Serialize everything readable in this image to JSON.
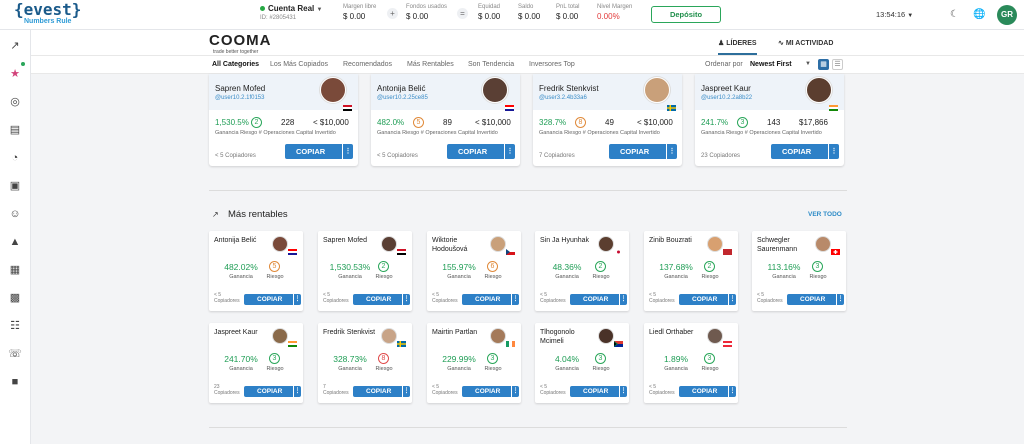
{
  "topbar": {
    "logo": "{evest}",
    "logo_tagline": "Numbers Rule",
    "account_name": "Cuenta Real",
    "account_id": "ID: #2805431",
    "stats": [
      {
        "label": "Margen libre",
        "value": "$ 0.00"
      },
      {
        "label": "Fondos usados",
        "value": "$ 0.00"
      },
      {
        "label": "Equidad",
        "value": "$ 0.00"
      },
      {
        "label": "Saldo",
        "value": "$ 0.00"
      },
      {
        "label": "PnL total",
        "value": "$ 0.00"
      },
      {
        "label": "Nivel Margen",
        "value": "0.00%"
      }
    ],
    "op_plus": "+",
    "op_eq": "=",
    "deposit_label": "Depósito",
    "clock": "13:54:16",
    "user_initials": "GR"
  },
  "cooma": {
    "logo": "COOMA",
    "tagline": "trade better together",
    "tab_leaders": "LÍDERES",
    "tab_activity": "MI ACTIVIDAD"
  },
  "filters": {
    "tabs": [
      "All Categories",
      "Los Más Copiados",
      "Recomendados",
      "Más Rentables",
      "Son Tendencia",
      "Inversores Top"
    ],
    "order_label": "Ordenar por",
    "order_value": "Newest First"
  },
  "labels": {
    "gain": "Ganancia",
    "risk": "Riesgo",
    "ops": "# Operaciones",
    "capital": "Capital Invertido",
    "copy": "COPIAR",
    "copiers_word": "Copiadores"
  },
  "top_cards": [
    {
      "name": "Sapren Mofed",
      "user": "@user10.2.1f0153",
      "gain": "1,530.5%",
      "risk": "2",
      "ops": "228",
      "capital": "< $10,000",
      "copiers": "< 5 Copiadores",
      "flag": "eg"
    },
    {
      "name": "Antonija Belić",
      "user": "@user10.2.25ce85",
      "gain": "482.0%",
      "risk": "5",
      "ops": "89",
      "capital": "< $10,000",
      "copiers": "< 5 Copiadores",
      "flag": "hr"
    },
    {
      "name": "Fredrik Stenkvist",
      "user": "@user3.2.4b33a6",
      "gain": "328.7%",
      "risk": "8",
      "ops": "49",
      "capital": "< $10,000",
      "copiers": "7 Copiadores",
      "flag": "se"
    },
    {
      "name": "Jaspreet Kaur",
      "user": "@user10.2.2a8b22",
      "gain": "241.7%",
      "risk": "3",
      "ops": "143",
      "capital": "$17,866",
      "copiers": "23 Copiadores",
      "flag": "in"
    }
  ],
  "section": {
    "title": "Más rentables",
    "view_all": "VER TODO"
  },
  "small_cards": [
    {
      "name": "Antonija Belić",
      "gain": "482.02%",
      "risk": "5",
      "copiers_count": "< 5",
      "flag": "hr"
    },
    {
      "name": "Sapren Mofed",
      "gain": "1,530.53%",
      "risk": "2",
      "copiers_count": "< 5",
      "flag": "eg"
    },
    {
      "name": "Wiktorie Hodoušová",
      "gain": "155.97%",
      "risk": "6",
      "copiers_count": "< 5",
      "flag": "cz"
    },
    {
      "name": "Sin Ja Hyunhak",
      "gain": "48.36%",
      "risk": "2",
      "copiers_count": "< 5",
      "flag": "kr"
    },
    {
      "name": "Zinib Bouzrati",
      "gain": "137.68%",
      "risk": "2",
      "copiers_count": "< 5",
      "flag": "ma"
    },
    {
      "name": "Schwegler Saurenmann",
      "gain": "113.16%",
      "risk": "3",
      "copiers_count": "< 5",
      "flag": "ch"
    },
    {
      "name": "Jaspreet Kaur",
      "gain": "241.70%",
      "risk": "3",
      "copiers_count": "23",
      "flag": "in"
    },
    {
      "name": "Fredrik Stenkvist",
      "gain": "328.73%",
      "risk": "8",
      "copiers_count": "7",
      "flag": "se"
    },
    {
      "name": "Mairtin Partlan",
      "gain": "229.99%",
      "risk": "3",
      "copiers_count": "< 5",
      "flag": "ie"
    },
    {
      "name": "Tlhogonolo Mcimeli",
      "gain": "4.04%",
      "risk": "3",
      "copiers_count": "< 5",
      "flag": "za"
    },
    {
      "name": "Liedl Orthaber",
      "gain": "1.89%",
      "risk": "3",
      "copiers_count": "< 5",
      "flag": "at"
    }
  ]
}
